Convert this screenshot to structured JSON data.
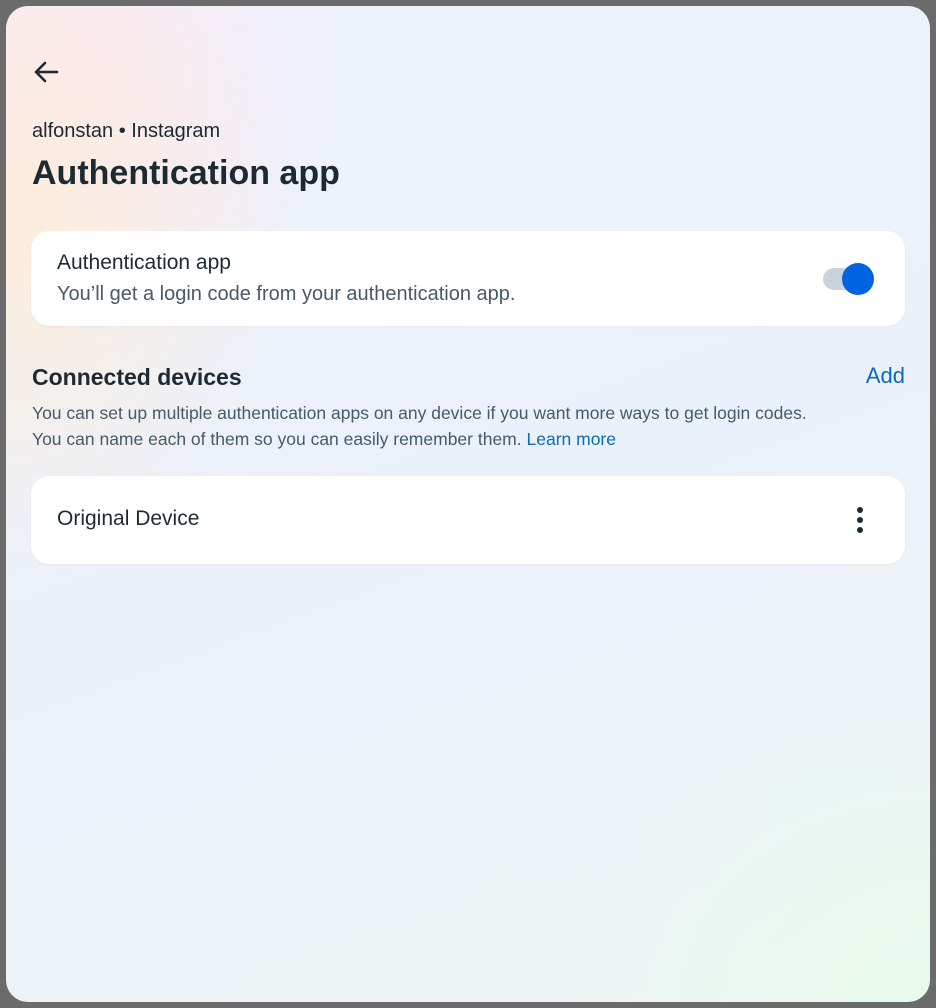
{
  "header": {
    "back_icon": "arrow-left-icon",
    "breadcrumb": "alfonstan • Instagram",
    "title": "Authentication app"
  },
  "auth_toggle": {
    "title": "Authentication app",
    "description": "You’ll get a login code from your authentication app.",
    "enabled": true,
    "accent_color": "#0064e0"
  },
  "connected_devices": {
    "title": "Connected devices",
    "add_label": "Add",
    "description_line1": "You can set up multiple authentication apps on any device if you want more ways to get login codes.",
    "description_line2": "You can name each of them so you can easily remember them.",
    "learn_more_label": "Learn more",
    "devices": [
      {
        "name": "Original Device",
        "menu_icon": "more-vertical-icon"
      }
    ]
  },
  "colors": {
    "text_primary": "#1c2b33",
    "text_secondary": "#465a69",
    "link": "#0a6bb6"
  }
}
